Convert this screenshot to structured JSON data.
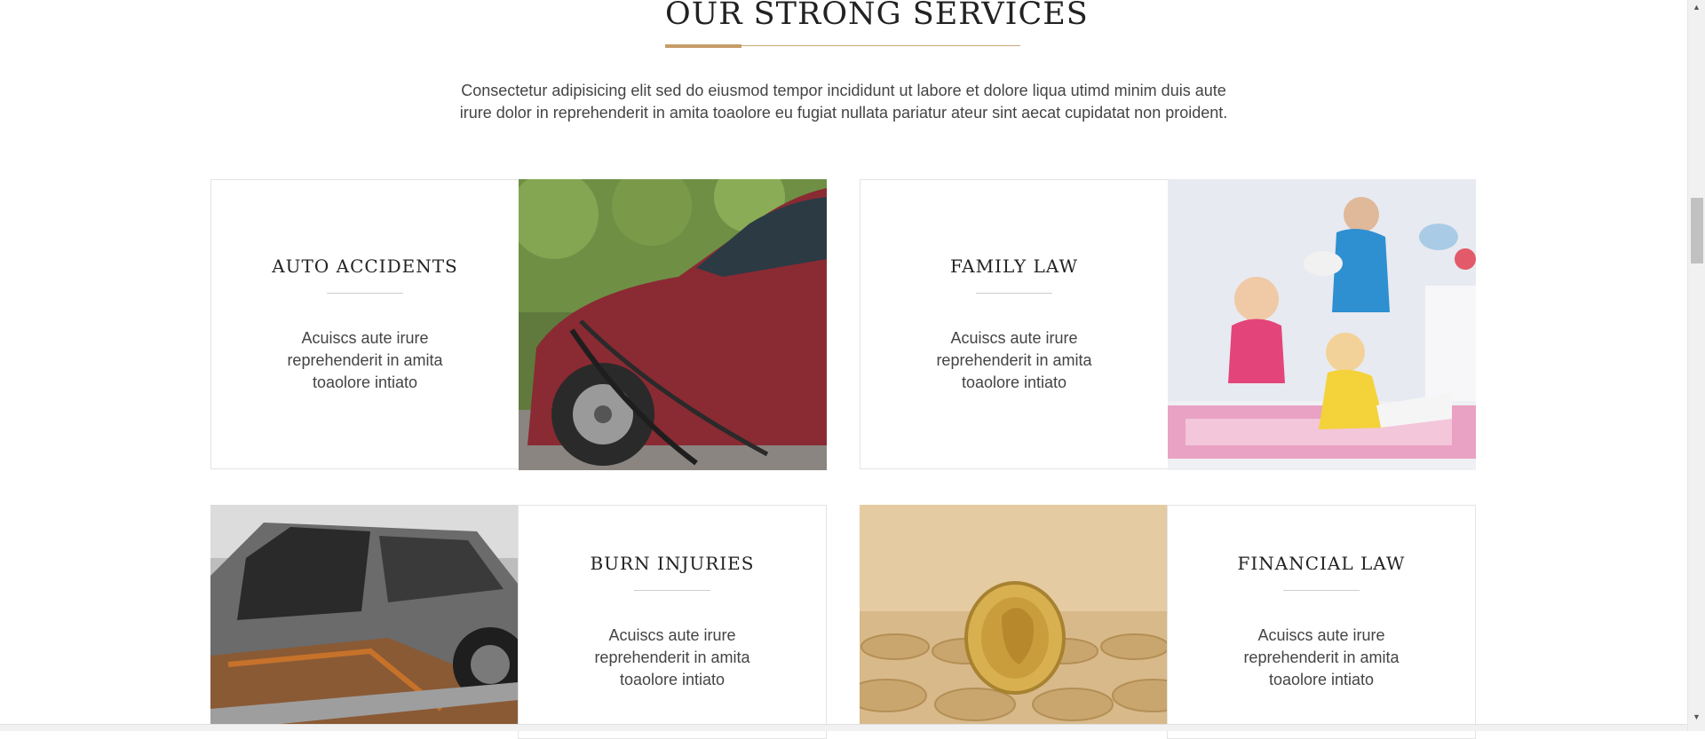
{
  "section": {
    "title": "OUR STRONG SERVICES",
    "intro_line1": "Consectetur adipisicing elit sed do eiusmod tempor incididunt ut labore et dolore liqua utimd minim duis aute",
    "intro_line2": "irure dolor in reprehenderit in amita toaolore eu fugiat nullata pariatur ateur sint aecat cupidatat non proident."
  },
  "services": [
    {
      "title": "AUTO ACCIDENTS",
      "text": "Acuiscs aute irure reprehenderit in amita toaolore intiato",
      "image_icon": "wrecked-car-photo"
    },
    {
      "title": "FAMILY LAW",
      "text": "Acuiscs aute irure reprehenderit in amita toaolore intiato",
      "image_icon": "family-photo"
    },
    {
      "title": "BURN INJURIES",
      "text": "Acuiscs aute irure reprehenderit in amita toaolore intiato",
      "image_icon": "burned-car-photo"
    },
    {
      "title": "FINANCIAL LAW",
      "text": "Acuiscs aute irure reprehenderit in amita toaolore intiato",
      "image_icon": "coins-photo"
    }
  ],
  "colors": {
    "accent": "#c69c68",
    "text": "#444444",
    "border": "#e4e4e4"
  },
  "scrollbar": {
    "up_arrow": "▲",
    "down_arrow": "▼"
  }
}
